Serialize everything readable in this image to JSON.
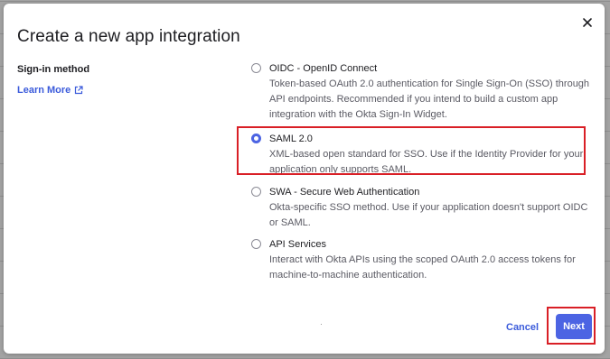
{
  "dialog": {
    "title": "Create a new app integration",
    "close_icon": "close-icon"
  },
  "sidebar": {
    "label": "Sign-in method",
    "link": "Learn More",
    "link_icon": "external-link-icon"
  },
  "options": [
    {
      "title": "OIDC - OpenID Connect",
      "desc": "Token-based OAuth 2.0 authentication for Single Sign-On (SSO) through API endpoints. Recommended if you intend to build a custom app integration with the Okta Sign-In Widget.",
      "selected": false
    },
    {
      "title": "SAML 2.0",
      "desc": "XML-based open standard for SSO. Use if the Identity Provider for your application only supports SAML.",
      "selected": true
    },
    {
      "title": "SWA - Secure Web Authentication",
      "desc": "Okta-specific SSO method. Use if your application doesn't support OIDC or SAML.",
      "selected": false
    },
    {
      "title": "API Services",
      "desc": "Interact with Okta APIs using the scoped OAuth 2.0 access tokens for machine-to-machine authentication.",
      "selected": false
    }
  ],
  "footer": {
    "cancel_label": "Cancel",
    "next_label": "Next"
  },
  "colors": {
    "accent": "#4c64e3",
    "link": "#3b5bdb",
    "highlight": "#d91f26"
  }
}
